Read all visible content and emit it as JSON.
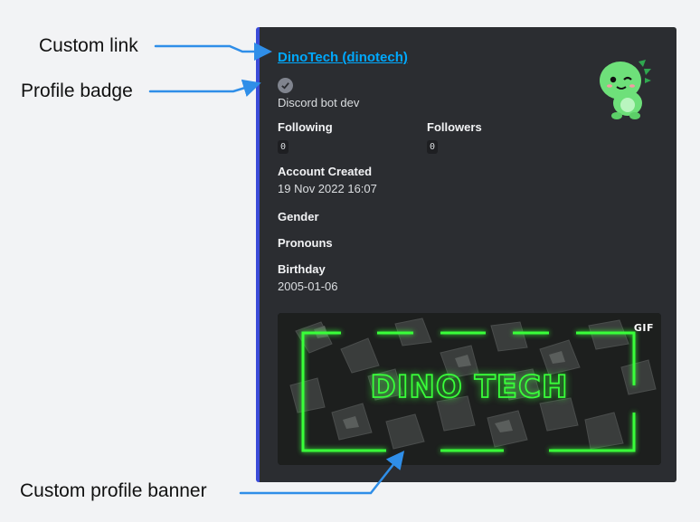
{
  "embed": {
    "title": "DinoTech (dinotech)",
    "description": "Discord bot dev",
    "fields": {
      "following": {
        "name": "Following",
        "value": "0"
      },
      "followers": {
        "name": "Followers",
        "value": "0"
      },
      "account_created": {
        "name": "Account Created",
        "value": "19 Nov 2022 16:07"
      },
      "gender": {
        "name": "Gender"
      },
      "pronouns": {
        "name": "Pronouns"
      },
      "birthday": {
        "name": "Birthday",
        "value": "2005-01-06"
      }
    },
    "banner": {
      "text": "DINO TECH",
      "gif_label": "GIF"
    },
    "thumbnail_icon": "dino-mascot-icon",
    "badge_icon": "check-badge-icon"
  },
  "annotations": {
    "custom_link": "Custom link",
    "profile_badge": "Profile badge",
    "custom_profile_banner": "Custom profile banner"
  },
  "colors": {
    "embed_bg": "#2b2d31",
    "accent_bar": "#3b4bd8",
    "link": "#00a8fc",
    "neon_green": "#39ff3a",
    "arrow": "#2f8ee8"
  }
}
